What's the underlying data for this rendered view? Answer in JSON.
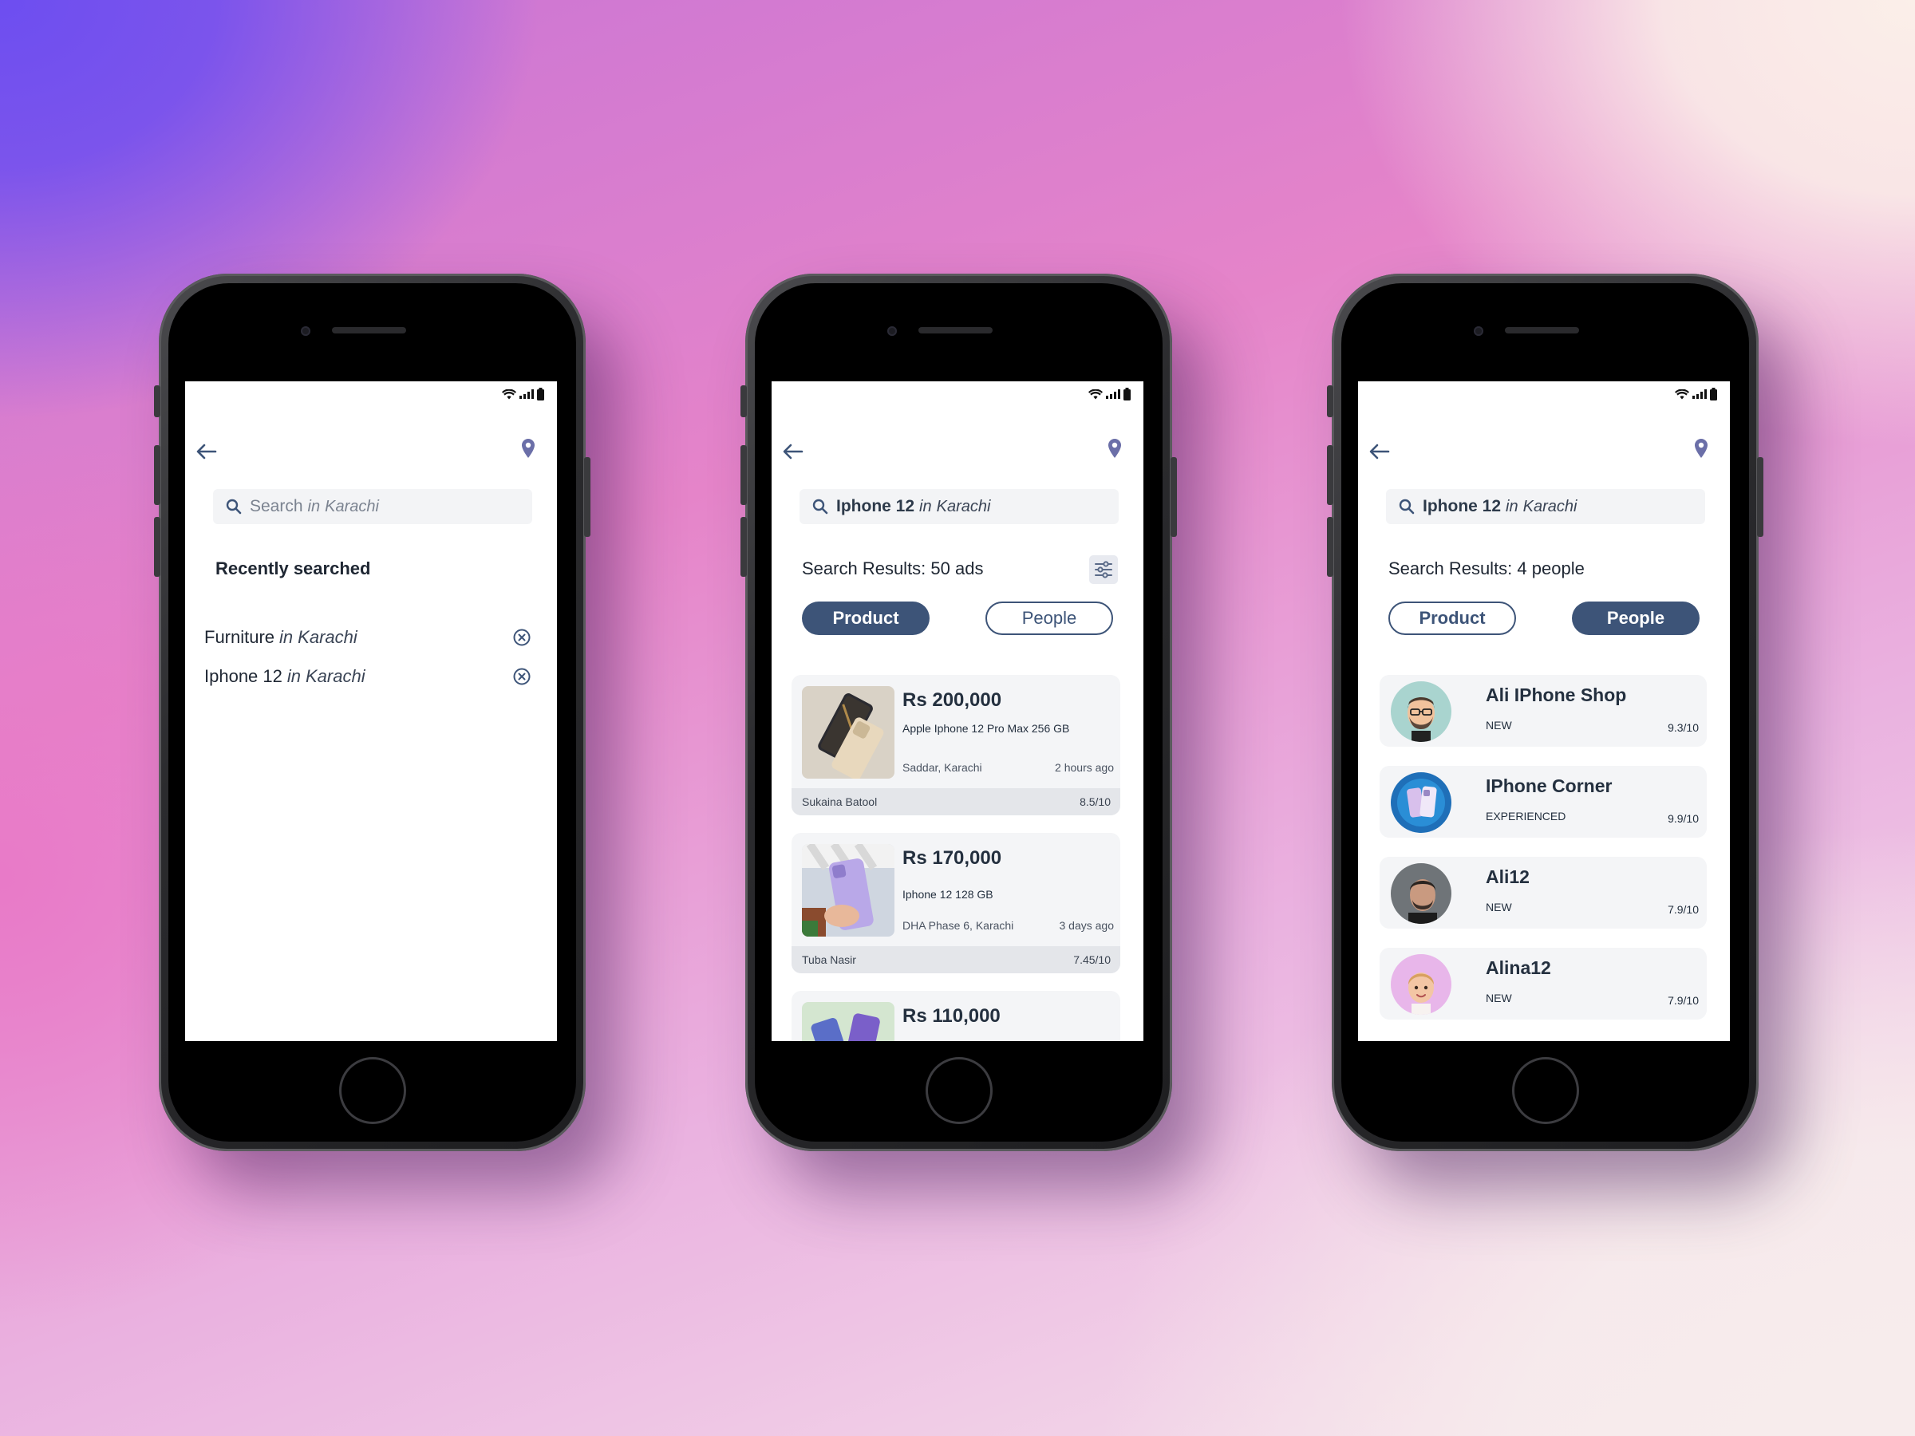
{
  "phones": {
    "recent": {
      "search": {
        "placeholder": "Search",
        "in": "in",
        "location": "Karachi"
      },
      "recent_title": "Recently searched",
      "items": [
        {
          "term": "Furniture",
          "in": "in",
          "location": "Karachi"
        },
        {
          "term": "Iphone 12",
          "in": "in",
          "location": "Karachi"
        }
      ]
    },
    "products": {
      "search": {
        "query": "Iphone 12",
        "in": "in",
        "location": "Karachi"
      },
      "results_title": "Search Results: 50 ads",
      "tabs": {
        "product": "Product",
        "people": "People"
      },
      "cards": [
        {
          "price": "Rs 200,000",
          "title": "Apple Iphone 12 Pro Max 256 GB",
          "area": "Saddar,  Karachi",
          "ago": "2 hours ago",
          "seller": "Sukaina Batool",
          "rating": "8.5/10"
        },
        {
          "price": "Rs 170,000",
          "title": "Iphone 12 128 GB",
          "area": "DHA Phase 6, Karachi",
          "ago": "3 days ago",
          "seller": "Tuba Nasir",
          "rating": "7.45/10"
        },
        {
          "price": "Rs 110,000"
        }
      ]
    },
    "people": {
      "search": {
        "query": "Iphone 12",
        "in": "in",
        "location": "Karachi"
      },
      "results_title": "Search Results: 4 people",
      "tabs": {
        "product": "Product",
        "people": "People"
      },
      "list": [
        {
          "name": "Ali IPhone Shop",
          "level": "NEW",
          "rating": "9.3/10"
        },
        {
          "name": "IPhone Corner",
          "level": "EXPERIENCED",
          "rating": "9.9/10"
        },
        {
          "name": "Ali12",
          "level": "NEW",
          "rating": "7.9/10"
        },
        {
          "name": "Alina12",
          "level": "NEW",
          "rating": "7.9/10"
        }
      ]
    }
  },
  "colors": {
    "primary": "#3d5478",
    "accent_icon": "#6b6fa8",
    "card_bg": "#f4f5f7"
  },
  "icons": [
    "back-arrow-icon",
    "location-pin-icon",
    "search-icon",
    "clear-icon",
    "filter-icon",
    "wifi-icon",
    "signal-icon",
    "battery-icon"
  ]
}
